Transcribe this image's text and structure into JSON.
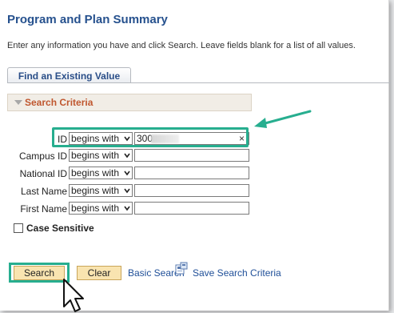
{
  "page": {
    "title": "Program and Plan Summary",
    "instructions": "Enter any information you have and click Search. Leave fields blank for a list of all values."
  },
  "tab": {
    "label": "Find an Existing Value"
  },
  "criteria": {
    "header": "Search Criteria",
    "fields": [
      {
        "label": "ID",
        "operator": "begins with",
        "value": "300"
      },
      {
        "label": "Campus ID",
        "operator": "begins with",
        "value": ""
      },
      {
        "label": "National ID",
        "operator": "begins with",
        "value": ""
      },
      {
        "label": "Last Name",
        "operator": "begins with",
        "value": ""
      },
      {
        "label": "First Name",
        "operator": "begins with",
        "value": ""
      }
    ],
    "clear_x": "×",
    "case_sensitive_label": "Case Sensitive"
  },
  "actions": {
    "search_label": "Search",
    "clear_label": "Clear",
    "basic_search_label": "Basic Search",
    "save_criteria_label": "Save Search Criteria"
  },
  "colors": {
    "title": "#26518e",
    "criteria_header_text": "#c0572f",
    "highlight": "#27ae8f",
    "button_fill": "#f9e4b0",
    "link": "#1f4f98"
  },
  "icons": [
    "triangle-down-icon",
    "chevron-down-icon",
    "save-criteria-icon",
    "annotation-arrow-icon",
    "mouse-pointer-icon"
  ]
}
